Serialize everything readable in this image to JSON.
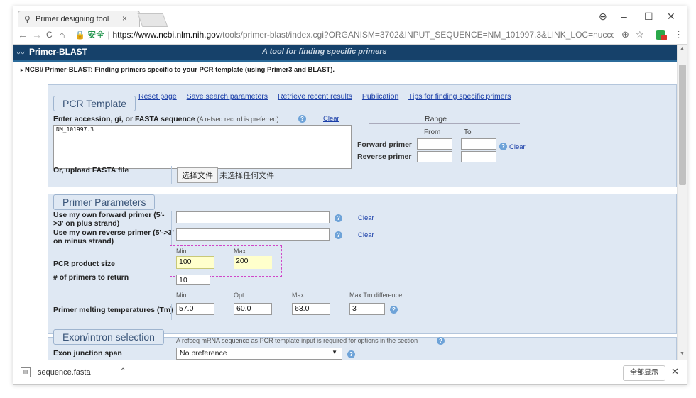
{
  "browser": {
    "tab_title": "Primer designing tool",
    "tab_close": "×",
    "secure_label": "安全",
    "url_host": "https://www.ncbi.nlm.nih.gov",
    "url_path": "/tools/primer-blast/index.cgi?ORGANISM=3702&INPUT_SEQUENCE=NM_101997.3&LINK_LOC=nuccore",
    "controls": {
      "profile": "⊖",
      "minimize": "–",
      "maximize": "☐",
      "close": "✕"
    },
    "nav": {
      "back": "←",
      "forward": "→",
      "reload": "C",
      "home": "⌂"
    },
    "zoom": "⊕",
    "star": "☆",
    "menu": "⋮"
  },
  "header": {
    "logo": "Primer-BLAST",
    "tagline": "A tool for finding specific primers"
  },
  "breadcrumb": "NCBI/ Primer-BLAST: Finding primers specific to your PCR template (using Primer3 and BLAST).",
  "top_links": [
    "Reset page",
    "Save search parameters",
    "Retrieve recent results",
    "Publication",
    "Tips for finding specific primers"
  ],
  "pcr_template": {
    "legend": "PCR Template",
    "accession_label": "Enter accession, gi, or FASTA sequence",
    "accession_note": "(A refseq record is preferred)",
    "clear": "Clear",
    "sequence_value": "NM_101997.3",
    "range_label": "Range",
    "from_label": "From",
    "to_label": "To",
    "forward_label": "Forward primer",
    "reverse_label": "Reverse primer",
    "range_clear": "Clear",
    "upload_label": "Or, upload FASTA file",
    "choose_file": "选择文件",
    "no_file": "未选择任何文件"
  },
  "primer_params": {
    "legend": "Primer Parameters",
    "own_forward": "Use my own forward primer (5'->3' on plus strand)",
    "own_reverse": "Use my own reverse primer (5'->3' on minus strand)",
    "clear": "Clear",
    "min_label": "Min",
    "max_label": "Max",
    "opt_label": "Opt",
    "product_size_label": "PCR product size",
    "product_min": "100",
    "product_max": "200",
    "num_primers_label": "# of primers to return",
    "num_primers": "10",
    "tm_label": "Primer melting temperatures (Tm)",
    "tm_min": "57.0",
    "tm_opt": "60.0",
    "tm_max": "63.0",
    "tm_diff_label": "Max Tm difference",
    "tm_diff": "3"
  },
  "exon": {
    "legend": "Exon/intron selection",
    "note": "A refseq mRNA sequence as PCR template input is required for options in the section",
    "junction_label": "Exon junction span",
    "junction_value": "No preference"
  },
  "download_bar": {
    "file_name": "sequence.fasta",
    "show_all": "全部显示",
    "close": "✕"
  }
}
